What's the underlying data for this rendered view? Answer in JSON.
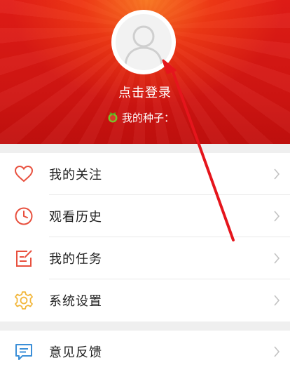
{
  "profile": {
    "login_label": "点击登录",
    "seeds_label": "我的种子："
  },
  "menu": {
    "items": [
      {
        "label": "我的关注",
        "icon": "heart-icon",
        "color": "#e8503e"
      },
      {
        "label": "观看历史",
        "icon": "clock-icon",
        "color": "#e8503e"
      },
      {
        "label": "我的任务",
        "icon": "task-icon",
        "color": "#e8503e"
      },
      {
        "label": "系统设置",
        "icon": "gear-icon",
        "color": "#f2b63a"
      }
    ],
    "feedback": {
      "label": "意见反馈",
      "icon": "feedback-icon",
      "color": "#3b8fd8"
    }
  },
  "colors": {
    "header_red": "#d9181a",
    "annotation_arrow": "#e5151c",
    "chevron": "#c2c2c2"
  }
}
